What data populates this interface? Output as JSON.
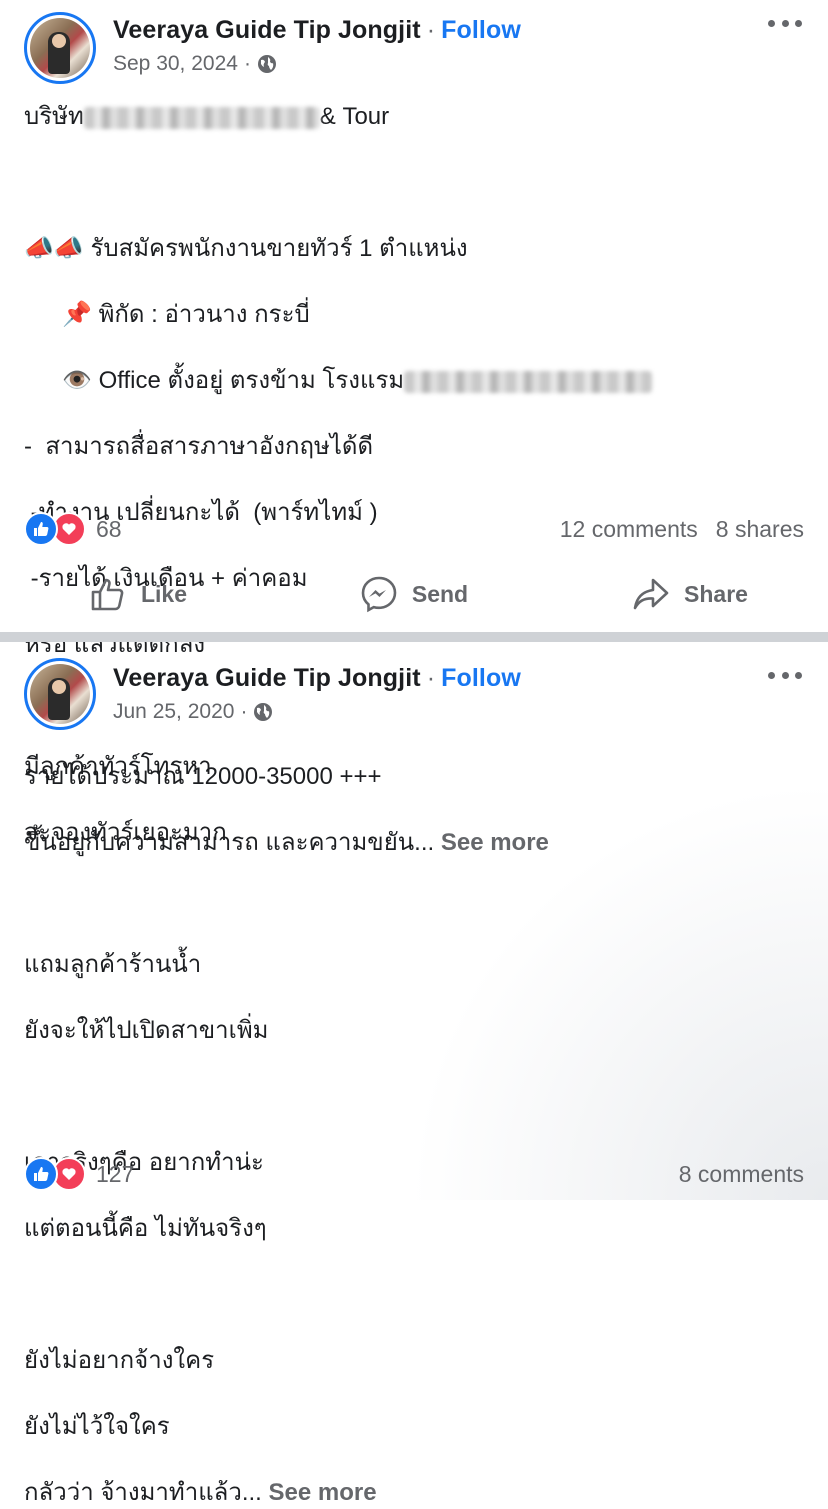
{
  "colors": {
    "accent": "#1877f2",
    "secondary_text": "#65676b",
    "love": "#f33e58",
    "divider": "#cfd2d6"
  },
  "posts": [
    {
      "author": "Veeraya Guide Tip Jongjit",
      "separator": "·",
      "follow_label": "Follow",
      "date": "Sep 30, 2024",
      "date_separator": "·",
      "audience_icon": "globe-icon",
      "lines": {
        "l1_start": "บริษัท",
        "l1_end": "& Tour",
        "l2_icons": "📣📣",
        "l2": "รับสมัครพนักงานขายทัวร์ 1 ตำแหน่ง",
        "l3_icon": "📌",
        "l3": "พิกัด : อ่าวนาง กระบี่",
        "l4_icon": "👁️",
        "l4": "Office ตั้งอยู่ ตรงข้าม โรงแรม",
        "l5": "-  สามารถสื่อสารภาษาอังกฤษได้ดี",
        "l6": " -ทำงาน เปลี่ยนกะได้  (พาร์ทไทม์ )",
        "l7": " -รายได้ เงินเดือน + ค่าคอม",
        "l8": "หรือ แล้วแต่ตกลง",
        "l9": "รายได้ประมาณ 12000-35000 +++",
        "l10": "ขึ้นอยู่กับความสามารถ และความขยัน..."
      },
      "see_more": "See more",
      "reaction_count": "68",
      "comments": "12 comments",
      "shares": "8 shares",
      "actions": {
        "like": "Like",
        "send": "Send",
        "share": "Share"
      }
    },
    {
      "author": "Veeraya Guide Tip Jongjit",
      "separator": "·",
      "follow_label": "Follow",
      "date": "Jun 25, 2020",
      "date_separator": "·",
      "audience_icon": "globe-icon",
      "lines": {
        "l1": "มีลูกค้าทัวร์โทรหา",
        "l2": "จะจองทัวร์เยอะมาก",
        "l3": "แถมลูกค้าร้านน้ำ",
        "l4": "ยังจะให้ไปเปิดสาขาเพิ่ม",
        "l5": "เอาจริงๆคือ อยากทำน่ะ",
        "l6": "แต่ตอนนี้คือ ไม่ทันจริงๆ",
        "l7": "ยังไม่อยากจ้างใคร",
        "l8": "ยังไม่ไว้ใจใคร",
        "l9": "กลัวว่า จ้างมาทำแล้ว..."
      },
      "see_more": "See more",
      "reaction_count": "127",
      "comments": "8 comments"
    }
  ]
}
